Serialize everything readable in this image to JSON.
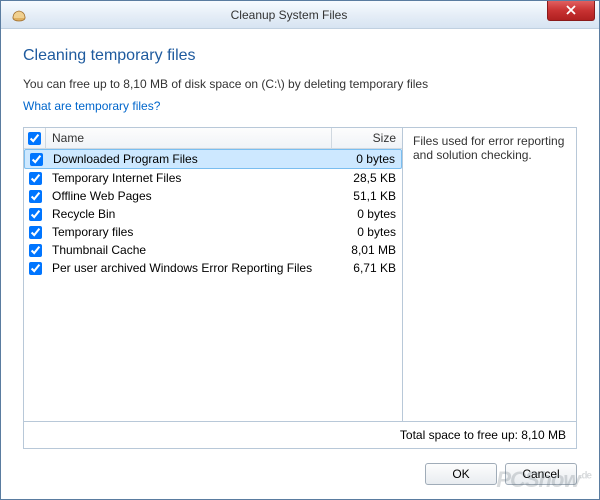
{
  "window": {
    "title": "Cleanup System Files"
  },
  "header": {
    "heading": "Cleaning temporary files",
    "subtext": "You can free up to 8,10 MB of disk space on (C:\\) by deleting temporary files",
    "link": "What are temporary files?"
  },
  "list": {
    "columns": {
      "name": "Name",
      "size": "Size"
    },
    "items": [
      {
        "checked": true,
        "name": "Downloaded Program Files",
        "size": "0 bytes",
        "selected": true
      },
      {
        "checked": true,
        "name": "Temporary Internet Files",
        "size": "28,5 KB",
        "selected": false
      },
      {
        "checked": true,
        "name": "Offline Web Pages",
        "size": "51,1 KB",
        "selected": false
      },
      {
        "checked": true,
        "name": "Recycle Bin",
        "size": "0 bytes",
        "selected": false
      },
      {
        "checked": true,
        "name": "Temporary files",
        "size": "0 bytes",
        "selected": false
      },
      {
        "checked": true,
        "name": "Thumbnail Cache",
        "size": "8,01 MB",
        "selected": false
      },
      {
        "checked": true,
        "name": "Per user archived Windows Error Reporting Files",
        "size": "6,71 KB",
        "selected": false
      }
    ]
  },
  "description": "Files used for error reporting and solution checking.",
  "total": "Total space to free up: 8,10 MB",
  "buttons": {
    "ok": "OK",
    "cancel": "Cancel"
  },
  "watermark": "PCShow",
  "watermark_sup": ".de"
}
